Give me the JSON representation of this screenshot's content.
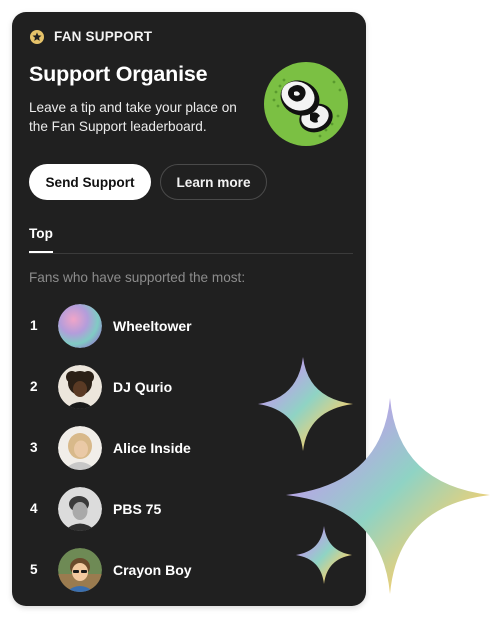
{
  "header": {
    "badge_label": "FAN SUPPORT",
    "badge_icon": "star-badge-icon"
  },
  "intro": {
    "title": "Support Organise",
    "description": "Leave a tip and take your place on the Fan Support leaderboard."
  },
  "actions": {
    "primary_label": "Send Support",
    "secondary_label": "Learn more"
  },
  "tabs": [
    {
      "label": "Top"
    }
  ],
  "leaderboard": {
    "subtitle": "Fans who have supported the most:",
    "fans": [
      {
        "rank": "1",
        "name": "Wheeltower"
      },
      {
        "rank": "2",
        "name": "DJ Qurio"
      },
      {
        "rank": "3",
        "name": "Alice Inside"
      },
      {
        "rank": "4",
        "name": "PBS 75"
      },
      {
        "rank": "5",
        "name": "Crayon Boy"
      }
    ]
  },
  "colors": {
    "card": "#202020",
    "accent_green": "#7bc043",
    "muted_text": "#8c8c8c"
  }
}
